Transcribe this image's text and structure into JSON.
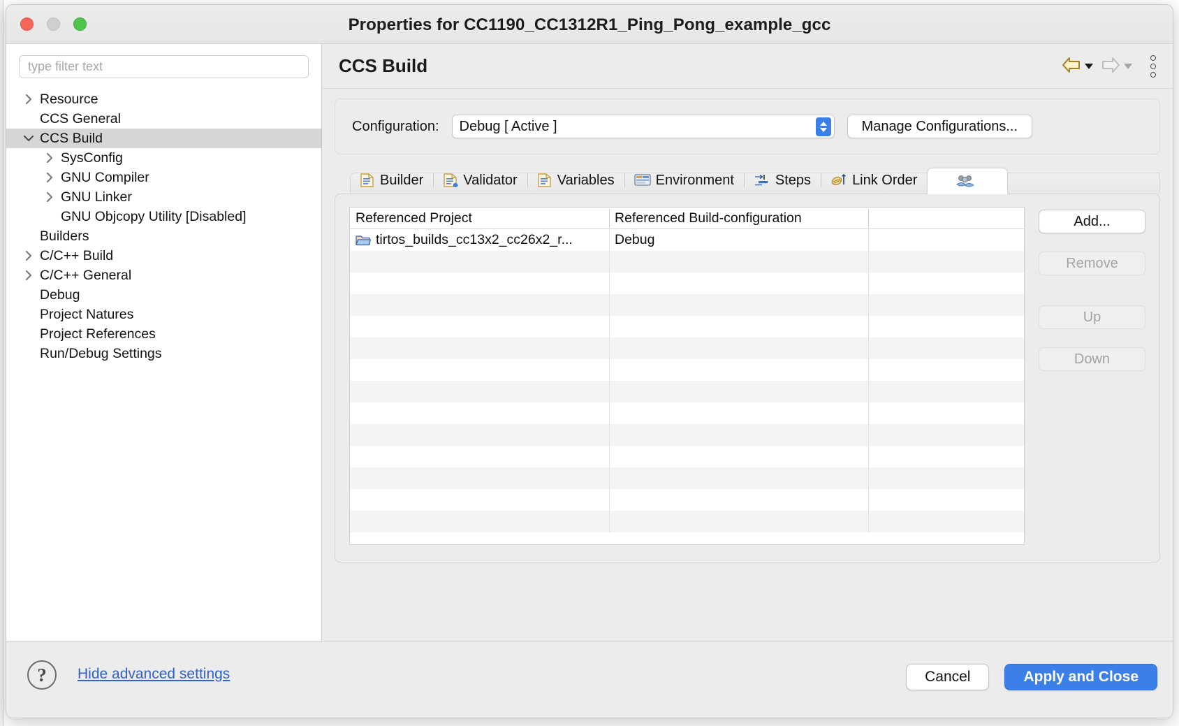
{
  "window": {
    "title": "Properties for CC1190_CC1312R1_Ping_Pong_example_gcc",
    "traffic_lights": [
      "close",
      "minimize",
      "zoom"
    ]
  },
  "sidebar": {
    "filter": {
      "placeholder": "type filter text",
      "value": ""
    },
    "items": [
      {
        "label": "Resource",
        "indent": 0,
        "twisty": "collapsed",
        "selected": false
      },
      {
        "label": "CCS General",
        "indent": 0,
        "twisty": "none",
        "selected": false
      },
      {
        "label": "CCS Build",
        "indent": 0,
        "twisty": "expanded",
        "selected": true
      },
      {
        "label": "SysConfig",
        "indent": 1,
        "twisty": "collapsed",
        "selected": false
      },
      {
        "label": "GNU Compiler",
        "indent": 1,
        "twisty": "collapsed",
        "selected": false
      },
      {
        "label": "GNU Linker",
        "indent": 1,
        "twisty": "collapsed",
        "selected": false
      },
      {
        "label": "GNU Objcopy Utility  [Disabled]",
        "indent": 1,
        "twisty": "none",
        "selected": false
      },
      {
        "label": "Builders",
        "indent": 0,
        "twisty": "none",
        "selected": false
      },
      {
        "label": "C/C++ Build",
        "indent": 0,
        "twisty": "collapsed",
        "selected": false
      },
      {
        "label": "C/C++ General",
        "indent": 0,
        "twisty": "collapsed",
        "selected": false
      },
      {
        "label": "Debug",
        "indent": 0,
        "twisty": "none",
        "selected": false
      },
      {
        "label": "Project Natures",
        "indent": 0,
        "twisty": "none",
        "selected": false
      },
      {
        "label": "Project References",
        "indent": 0,
        "twisty": "none",
        "selected": false
      },
      {
        "label": "Run/Debug Settings",
        "indent": 0,
        "twisty": "none",
        "selected": false
      }
    ]
  },
  "main": {
    "page_title": "CCS Build",
    "nav": {
      "back_icon": "back-arrow-icon",
      "forward_icon": "forward-arrow-icon",
      "menu_icon": "kebab-menu-icon"
    },
    "configuration": {
      "label": "Configuration:",
      "value": "Debug  [ Active ]",
      "manage_label": "Manage Configurations..."
    },
    "tabs": [
      {
        "label": "Builder",
        "icon": "document-builder-icon",
        "selected": false
      },
      {
        "label": "Validator",
        "icon": "document-validator-icon",
        "selected": false
      },
      {
        "label": "Variables",
        "icon": "document-variables-icon",
        "selected": false
      },
      {
        "label": "Environment",
        "icon": "environment-icon",
        "selected": false
      },
      {
        "label": "Steps",
        "icon": "steps-icon",
        "selected": false
      },
      {
        "label": "Link Order",
        "icon": "link-order-icon",
        "selected": false
      },
      {
        "label": "",
        "icon": "dependencies-icon",
        "selected": true
      }
    ],
    "table": {
      "columns": [
        "Referenced Project",
        "Referenced Build-configuration",
        ""
      ],
      "rows": [
        {
          "project": "tirtos_builds_cc13x2_cc26x2_r...",
          "config": "Debug",
          "extra": "",
          "icon": "folder-icon"
        }
      ],
      "empty_row_count": 13
    },
    "side_buttons": [
      {
        "label": "Add...",
        "enabled": true
      },
      {
        "label": "Remove",
        "enabled": false
      },
      {
        "label": "Up",
        "enabled": false
      },
      {
        "label": "Down",
        "enabled": false
      }
    ]
  },
  "footer": {
    "help_icon": "help-question-icon",
    "advanced_link": "Hide advanced settings",
    "cancel_label": "Cancel",
    "apply_label": "Apply and Close"
  },
  "colors": {
    "accent_blue": "#3b7fe8",
    "link_blue": "#2f62c8",
    "window_bg": "#ececec",
    "selection_gray": "#d6d6d6"
  }
}
